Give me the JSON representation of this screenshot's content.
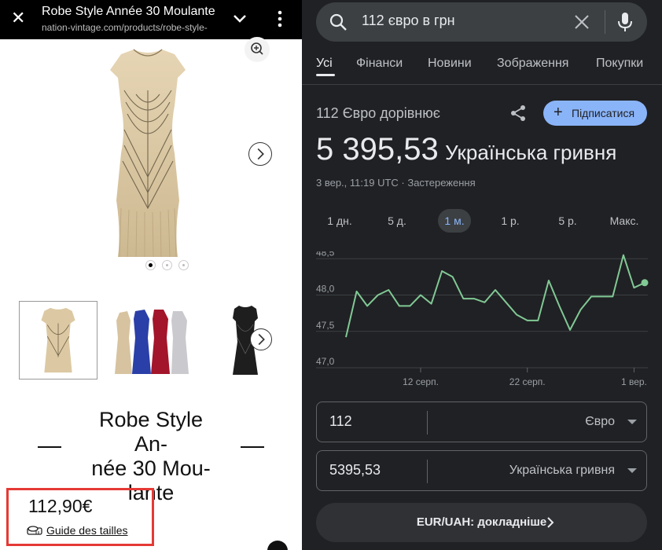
{
  "left": {
    "header": {
      "title": "Robe Style Année 30 Moulante -",
      "url": "nation-vintage.com/products/robe-style-"
    },
    "product": {
      "title_lines": [
        "Robe Style An-",
        "née 30 Mou-",
        "lante"
      ],
      "price": "112,90€",
      "size_guide": "Guide des tailles"
    },
    "carousel": {
      "dots": 3,
      "active_index": 0
    }
  },
  "right": {
    "search": {
      "query": "112 євро в грн"
    },
    "tabs": [
      {
        "label": "Усі",
        "active": true
      },
      {
        "label": "Фінанси",
        "active": false
      },
      {
        "label": "Новини",
        "active": false
      },
      {
        "label": "Зображення",
        "active": false
      },
      {
        "label": "Покупки",
        "active": false
      }
    ],
    "conversion": {
      "equals_label": "112 Євро дорівнює",
      "subscribe_label": "Підписатися",
      "result_value": "5 395,53",
      "result_currency": "Українська гривня",
      "meta": "3 вер., 11:19 UTC · Застереження"
    },
    "ranges": [
      {
        "label": "1 дн.",
        "active": false
      },
      {
        "label": "5 д.",
        "active": false
      },
      {
        "label": "1 м.",
        "active": true
      },
      {
        "label": "1 р.",
        "active": false
      },
      {
        "label": "5 р.",
        "active": false
      },
      {
        "label": "Макс.",
        "active": false
      }
    ],
    "converter": {
      "from_value": "112",
      "from_unit": "Євро",
      "to_value": "5395,53",
      "to_unit": "Українська гривня"
    },
    "details_button": "EUR/UAH: докладніше",
    "colors": {
      "line": "#81c995",
      "accent": "#8ab4f8",
      "background": "#202124"
    }
  },
  "chart_data": {
    "type": "line",
    "title": "",
    "ylim": [
      47.0,
      48.6
    ],
    "yticks": [
      "48,5",
      "48,0",
      "47,5",
      "47,0"
    ],
    "ytick_values": [
      48.5,
      48.0,
      47.5,
      47.0
    ],
    "xtick_labels": [
      "12 серп.",
      "22 серп.",
      "1 вер."
    ],
    "xtick_index": [
      7,
      17,
      27
    ],
    "grid": true,
    "series": [
      {
        "values": [
          47.42,
          48.05,
          47.85,
          48.0,
          48.07,
          47.85,
          47.85,
          48.0,
          47.88,
          48.33,
          48.25,
          47.95,
          47.95,
          47.9,
          48.07,
          47.9,
          47.73,
          47.65,
          47.65,
          48.2,
          47.85,
          47.52,
          47.8,
          47.98,
          47.98,
          47.98,
          48.55,
          48.1,
          48.17
        ]
      }
    ]
  }
}
